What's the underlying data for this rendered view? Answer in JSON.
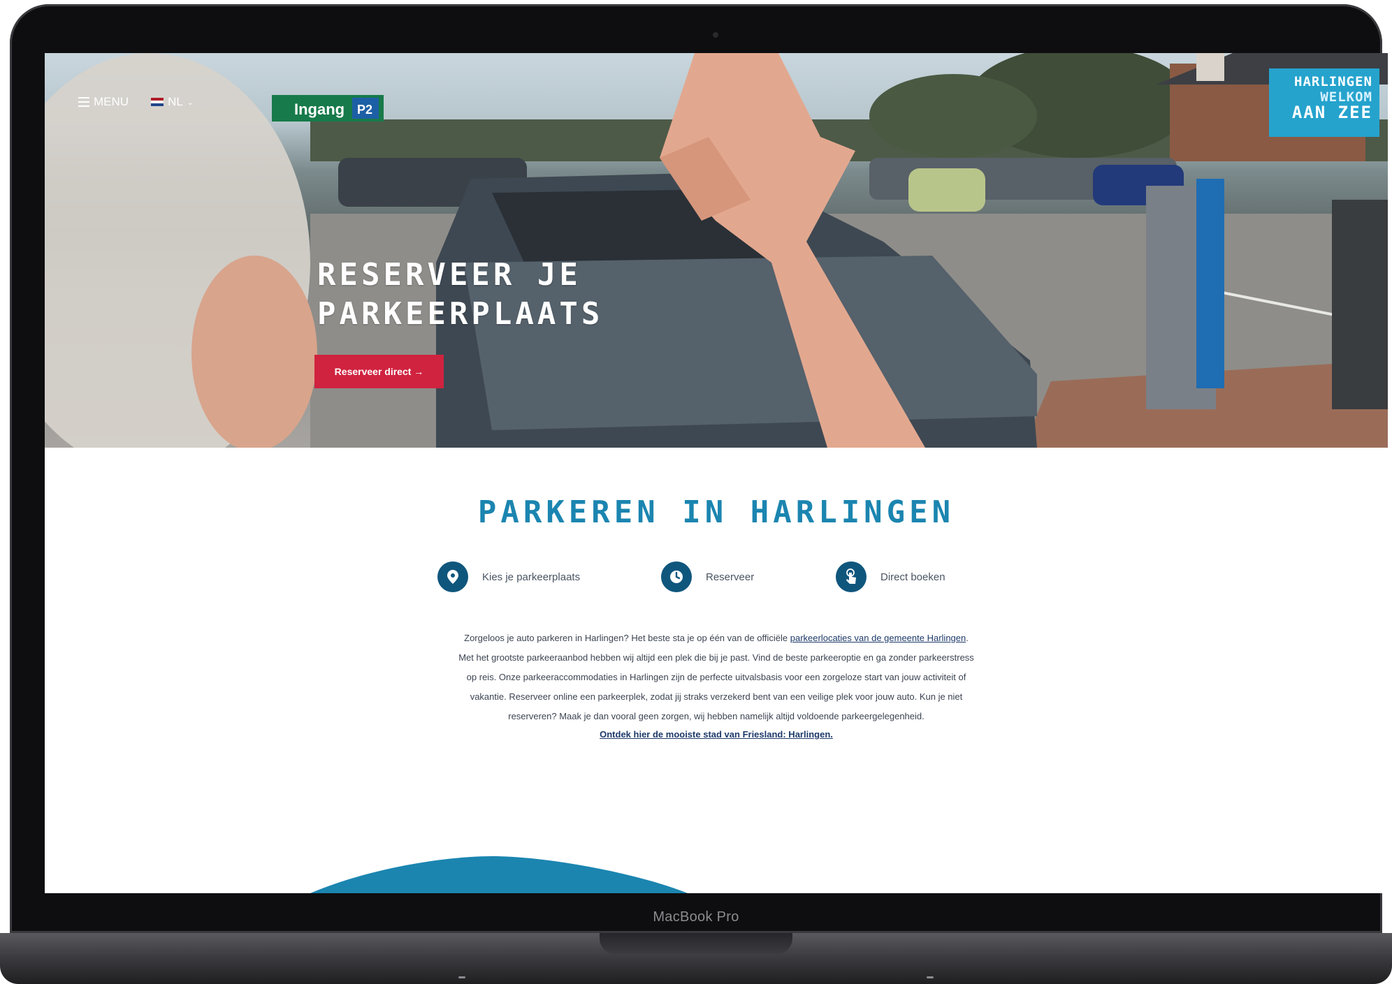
{
  "device": {
    "label": "MacBook Pro"
  },
  "nav": {
    "menu_label": "MENU",
    "language_label": "NL"
  },
  "logo": {
    "line1": "HARLINGEN",
    "line2": "WELKOM",
    "line3": "AAN ZEE"
  },
  "hero": {
    "sign_text": "Ingang",
    "sign_badge": "P2",
    "title": "RESERVEER JE\nPARKEERPLAATS",
    "cta_label": "Reserveer direct →"
  },
  "section": {
    "title": "PARKEREN IN HARLINGEN",
    "steps": [
      {
        "label": "Kies je parkeerplaats",
        "icon": "map-pin-icon"
      },
      {
        "label": "Reserveer",
        "icon": "clock-icon"
      },
      {
        "label": "Direct boeken",
        "icon": "tap-hand-icon"
      }
    ],
    "intro_before": "Zorgeloos je auto parkeren in Harlingen? Het beste sta je op één van de officiële ",
    "intro_link": "parkeerlocaties van de gemeente Harlingen",
    "intro_after": ". Met het grootste parkeeraanbod hebben wij altijd een plek die bij je past. Vind de beste parkeeroptie en ga zonder parkeerstress op reis. Onze parkeeraccommodaties in Harlingen zijn de perfecte uitvalsbasis voor een zorgeloze start van jouw activiteit of vakantie. Reserveer online een parkeerplek, zodat jij straks verzekerd bent van een veilige plek voor jouw auto. Kun je niet reserveren? Maak je dan vooral geen zorgen, wij hebben namelijk altijd voldoende parkeergelegenheid.",
    "discover_link": "Ontdek hier de mooiste stad van Friesland: Harlingen."
  },
  "colors": {
    "brand_blue": "#1b85b0",
    "icon_navy": "#0f567d",
    "cta_red": "#d0233f",
    "logo_cyan": "#25a3cd"
  }
}
